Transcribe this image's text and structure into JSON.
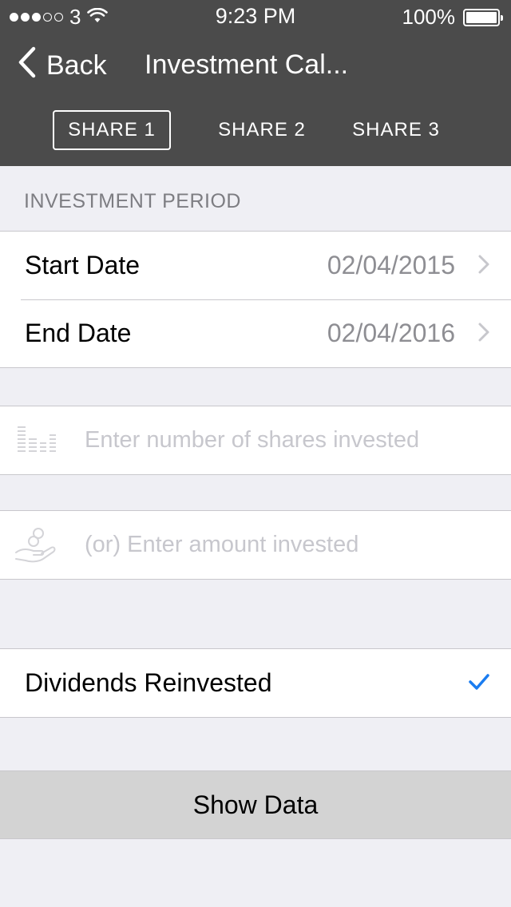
{
  "status_bar": {
    "carrier": "3",
    "time": "9:23 PM",
    "battery": "100%",
    "signal_bars_filled": 3,
    "signal_bars_total": 5
  },
  "nav": {
    "back_label": "Back",
    "title": "Investment Cal..."
  },
  "tabs": [
    {
      "label": "SHARE 1",
      "active": true
    },
    {
      "label": "SHARE 2",
      "active": false
    },
    {
      "label": "SHARE 3",
      "active": false
    }
  ],
  "investment_period": {
    "header": "INVESTMENT PERIOD",
    "start_label": "Start Date",
    "start_value": "02/04/2015",
    "end_label": "End Date",
    "end_value": "02/04/2016"
  },
  "shares_input": {
    "placeholder": "Enter number of shares invested",
    "icon": "shares-icon"
  },
  "amount_input": {
    "placeholder": "(or) Enter amount invested",
    "icon": "money-hand-icon"
  },
  "dividends": {
    "label": "Dividends Reinvested",
    "checked": true
  },
  "show_data_label": "Show Data",
  "colors": {
    "nav_bg": "#4b4b4b",
    "page_bg": "#efeff4",
    "accent": "#1a7cf0",
    "secondary_text": "#8e8e93",
    "button_bg": "#d3d3d3"
  }
}
